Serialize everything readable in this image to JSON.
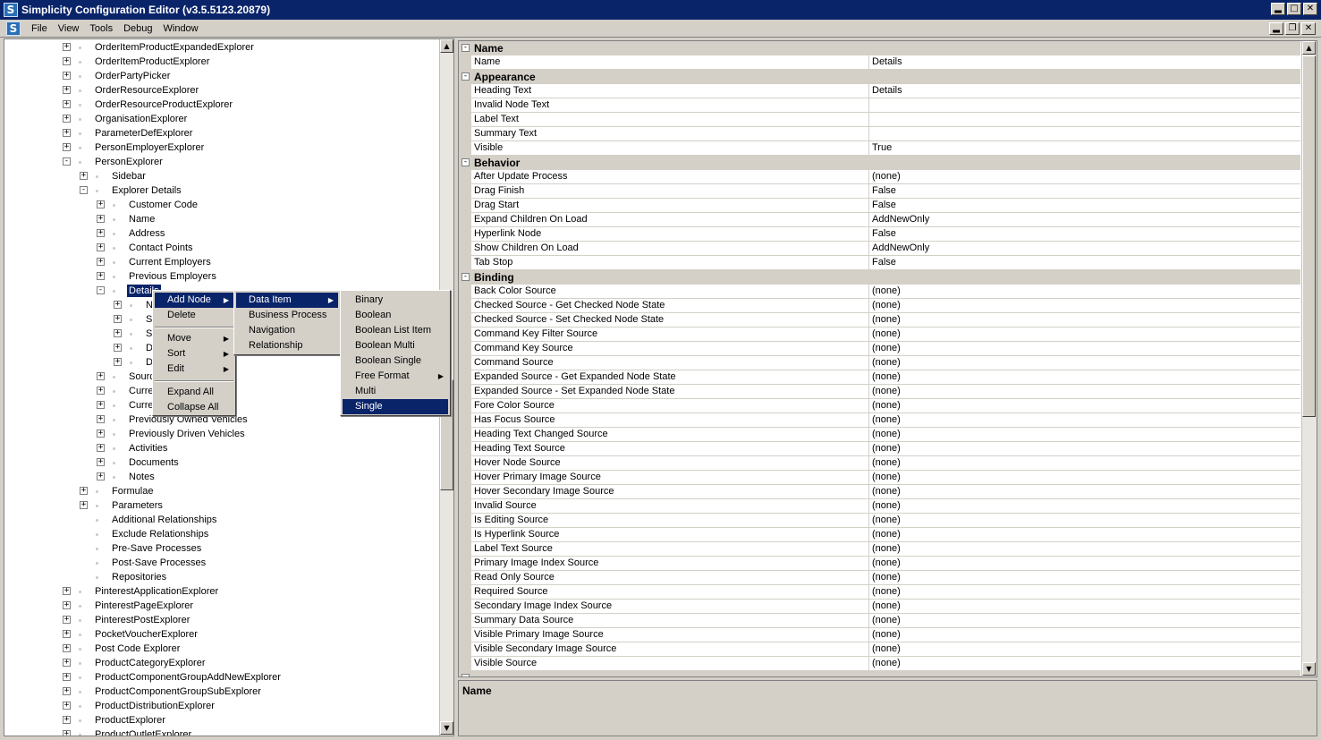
{
  "window": {
    "title": "Simplicity Configuration Editor (v3.5.5123.20879)",
    "app_icon_letter": "S"
  },
  "menubar": {
    "items": [
      "File",
      "View",
      "Tools",
      "Debug",
      "Window"
    ]
  },
  "tree": {
    "rows": [
      {
        "label": "OrderItemProductExpandedExplorer",
        "level": 0,
        "toggle": "+"
      },
      {
        "label": "OrderItemProductExplorer",
        "level": 0,
        "toggle": "+"
      },
      {
        "label": "OrderPartyPicker",
        "level": 0,
        "toggle": "+"
      },
      {
        "label": "OrderResourceExplorer",
        "level": 0,
        "toggle": "+"
      },
      {
        "label": "OrderResourceProductExplorer",
        "level": 0,
        "toggle": "+"
      },
      {
        "label": "OrganisationExplorer",
        "level": 0,
        "toggle": "+"
      },
      {
        "label": "ParameterDefExplorer",
        "level": 0,
        "toggle": "+"
      },
      {
        "label": "PersonEmployerExplorer",
        "level": 0,
        "toggle": "+"
      },
      {
        "label": "PersonExplorer",
        "level": 0,
        "toggle": "-"
      },
      {
        "label": "Sidebar",
        "level": 1,
        "toggle": "+"
      },
      {
        "label": "Explorer Details",
        "level": 1,
        "toggle": "-"
      },
      {
        "label": "Customer Code",
        "level": 2,
        "toggle": "+"
      },
      {
        "label": "Name",
        "level": 2,
        "toggle": "+"
      },
      {
        "label": "Address",
        "level": 2,
        "toggle": "+"
      },
      {
        "label": "Contact Points",
        "level": 2,
        "toggle": "+"
      },
      {
        "label": "Current Employers",
        "level": 2,
        "toggle": "+"
      },
      {
        "label": "Previous Employers",
        "level": 2,
        "toggle": "+"
      },
      {
        "label": "Details",
        "level": 2,
        "toggle": "-",
        "selected": true
      },
      {
        "label": "N",
        "level": 3,
        "toggle": "+"
      },
      {
        "label": "S",
        "level": 3,
        "toggle": "+"
      },
      {
        "label": "S",
        "level": 3,
        "toggle": "+"
      },
      {
        "label": "D",
        "level": 3,
        "toggle": "+"
      },
      {
        "label": "D",
        "level": 3,
        "toggle": "+"
      },
      {
        "label": "Sourc",
        "level": 2,
        "toggle": "+"
      },
      {
        "label": "Curre",
        "level": 2,
        "toggle": "+"
      },
      {
        "label": "Curre",
        "level": 2,
        "toggle": "+"
      },
      {
        "label": "Previously Owned Vehicles",
        "level": 2,
        "toggle": "+"
      },
      {
        "label": "Previously Driven Vehicles",
        "level": 2,
        "toggle": "+"
      },
      {
        "label": "Activities",
        "level": 2,
        "toggle": "+"
      },
      {
        "label": "Documents",
        "level": 2,
        "toggle": "+"
      },
      {
        "label": "Notes",
        "level": 2,
        "toggle": "+"
      },
      {
        "label": "Formulae",
        "level": 1,
        "toggle": "+"
      },
      {
        "label": "Parameters",
        "level": 1,
        "toggle": "+"
      },
      {
        "label": "Additional Relationships",
        "level": 1,
        "toggle": ""
      },
      {
        "label": "Exclude Relationships",
        "level": 1,
        "toggle": ""
      },
      {
        "label": "Pre-Save Processes",
        "level": 1,
        "toggle": ""
      },
      {
        "label": "Post-Save Processes",
        "level": 1,
        "toggle": ""
      },
      {
        "label": "Repositories",
        "level": 1,
        "toggle": ""
      },
      {
        "label": "PinterestApplicationExplorer",
        "level": 0,
        "toggle": "+"
      },
      {
        "label": "PinterestPageExplorer",
        "level": 0,
        "toggle": "+"
      },
      {
        "label": "PinterestPostExplorer",
        "level": 0,
        "toggle": "+"
      },
      {
        "label": "PocketVoucherExplorer",
        "level": 0,
        "toggle": "+"
      },
      {
        "label": "Post Code Explorer",
        "level": 0,
        "toggle": "+"
      },
      {
        "label": "ProductCategoryExplorer",
        "level": 0,
        "toggle": "+"
      },
      {
        "label": "ProductComponentGroupAddNewExplorer",
        "level": 0,
        "toggle": "+"
      },
      {
        "label": "ProductComponentGroupSubExplorer",
        "level": 0,
        "toggle": "+"
      },
      {
        "label": "ProductDistributionExplorer",
        "level": 0,
        "toggle": "+"
      },
      {
        "label": "ProductExplorer",
        "level": 0,
        "toggle": "+"
      },
      {
        "label": "ProductOutletExplorer",
        "level": 0,
        "toggle": "+"
      }
    ]
  },
  "context_menu": {
    "main": [
      {
        "label": "Add Node",
        "submenu": true,
        "highlighted": true
      },
      {
        "label": "Delete"
      },
      {
        "sep": true
      },
      {
        "label": "Move",
        "submenu": true
      },
      {
        "label": "Sort",
        "submenu": true
      },
      {
        "label": "Edit",
        "submenu": true
      },
      {
        "sep": true
      },
      {
        "label": "Expand All"
      },
      {
        "label": "Collapse All"
      }
    ],
    "add_node": [
      {
        "label": "Data Item",
        "submenu": true,
        "highlighted": true
      },
      {
        "label": "Business Process"
      },
      {
        "label": "Navigation"
      },
      {
        "label": "Relationship"
      }
    ],
    "data_item": [
      {
        "label": "Binary"
      },
      {
        "label": "Boolean"
      },
      {
        "label": "Boolean List Item"
      },
      {
        "label": "Boolean Multi"
      },
      {
        "label": "Boolean Single"
      },
      {
        "label": "Free Format",
        "submenu": true
      },
      {
        "label": "Multi"
      },
      {
        "label": "Single",
        "highlighted": true
      }
    ]
  },
  "properties": {
    "rows": [
      {
        "category": "Name"
      },
      {
        "name": "Name",
        "value": "Details"
      },
      {
        "category": "Appearance"
      },
      {
        "name": "Heading Text",
        "value": "Details"
      },
      {
        "name": "Invalid Node Text",
        "value": ""
      },
      {
        "name": "Label Text",
        "value": ""
      },
      {
        "name": "Summary Text",
        "value": ""
      },
      {
        "name": "Visible",
        "value": "True"
      },
      {
        "category": "Behavior"
      },
      {
        "name": "After Update Process",
        "value": "(none)"
      },
      {
        "name": "Drag Finish",
        "value": "False"
      },
      {
        "name": "Drag Start",
        "value": "False"
      },
      {
        "name": "Expand Children On Load",
        "value": "AddNewOnly"
      },
      {
        "name": "Hyperlink Node",
        "value": "False"
      },
      {
        "name": "Show Children On Load",
        "value": "AddNewOnly"
      },
      {
        "name": "Tab Stop",
        "value": "False"
      },
      {
        "category": "Binding"
      },
      {
        "name": "Back Color Source",
        "value": "(none)"
      },
      {
        "name": "Checked Source - Get Checked Node State",
        "value": "(none)"
      },
      {
        "name": "Checked Source - Set Checked Node State",
        "value": "(none)"
      },
      {
        "name": "Command Key Filter Source",
        "value": "(none)"
      },
      {
        "name": "Command Key Source",
        "value": "(none)"
      },
      {
        "name": "Command Source",
        "value": "(none)"
      },
      {
        "name": "Expanded Source - Get Expanded Node State",
        "value": "(none)"
      },
      {
        "name": "Expanded Source - Set Expanded Node State",
        "value": "(none)"
      },
      {
        "name": "Fore Color Source",
        "value": "(none)"
      },
      {
        "name": "Has Focus Source",
        "value": "(none)"
      },
      {
        "name": "Heading Text Changed Source",
        "value": "(none)"
      },
      {
        "name": "Heading Text Source",
        "value": "(none)"
      },
      {
        "name": "Hover Node Source",
        "value": "(none)"
      },
      {
        "name": "Hover Primary Image Source",
        "value": "(none)"
      },
      {
        "name": "Hover Secondary Image Source",
        "value": "(none)"
      },
      {
        "name": "Invalid Source",
        "value": "(none)"
      },
      {
        "name": "Is Editing Source",
        "value": "(none)"
      },
      {
        "name": "Is Hyperlink Source",
        "value": "(none)"
      },
      {
        "name": "Label Text Source",
        "value": "(none)"
      },
      {
        "name": "Primary Image Index Source",
        "value": "(none)"
      },
      {
        "name": "Read Only Source",
        "value": "(none)"
      },
      {
        "name": "Required Source",
        "value": "(none)"
      },
      {
        "name": "Secondary Image Index Source",
        "value": "(none)"
      },
      {
        "name": "Summary Data Source",
        "value": "(none)"
      },
      {
        "name": "Visible Primary Image Source",
        "value": "(none)"
      },
      {
        "name": "Visible Secondary Image Source",
        "value": "(none)"
      },
      {
        "name": "Visible Source",
        "value": "(none)"
      }
    ]
  },
  "description": {
    "title": "Name"
  },
  "colors": {
    "titlebar": "#0a246a",
    "selection": "#0a246a",
    "chrome": "#d4d0c8"
  }
}
